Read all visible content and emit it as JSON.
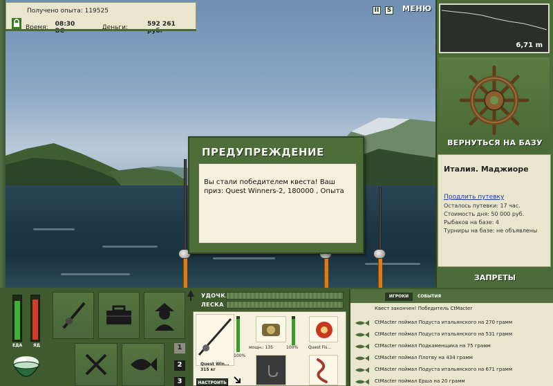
{
  "info": {
    "experience": "Получено опыта: 119525",
    "time_label": "Время:",
    "time_value": "08:30 ВС",
    "money_label": "Деньги:",
    "money_value": "592 261 руб."
  },
  "top_buttons": {
    "pause": "II",
    "sound": "S",
    "menu": "МЕНЮ"
  },
  "depth": {
    "value": "6,71 m"
  },
  "return_button": "ВЕРНУТЬСЯ НА БАЗУ",
  "location": {
    "title": "Италия. Маджиоре",
    "extend_link": "Продлить путевку",
    "lines": [
      "Осталось путевки: 17 час.",
      "Стоимость дня: 50 000 руб.",
      "Рыбаков на базе: 4",
      "Турниры на базе: не объявлены"
    ]
  },
  "bans_button": "ЗАПРЕТЫ",
  "modal": {
    "title": "ПРЕДУПРЕЖДЕНИЕ",
    "body": "Вы стали победителем квеста! Ваш приз: Quest Winners-2, 180000 , Опыта"
  },
  "meters": {
    "food_label": "ЕДА",
    "poison_label": "ЯД",
    "food_level": 0.88,
    "poison_level": 0.9,
    "food_color": "#3fb03a",
    "poison_color": "#d83a2a"
  },
  "bottom_tabs": [
    "1",
    "2",
    "3"
  ],
  "gear": {
    "rod_label": "УДОЧКА",
    "line_label": "ЛЕСКА",
    "rod_name": "Quest Win...",
    "rod_weight": "315 кг",
    "rod_percent": "100%",
    "reel_name": "мощн.: 135",
    "reel_percent": "100%",
    "item3_name": "Quest Fis...",
    "setup_button": "НАСТРОИТЬ"
  },
  "chat": {
    "tab_players": "ИГРОКИ",
    "tab_events": "СОБЫТИЯ",
    "first_line": "Квест закончен! Победитель CtMacter",
    "messages": [
      "CtMacter поймал Подуста итальянского на 270 грамм",
      "CtMacter поймал Подуста итальянского на 531 грамм",
      "CtMacter поймал Подкаменщика на 75 грамм",
      "CtMacter поймал Плотву на 434 грамм",
      "CtMacter поймал Подуста итальянского на 671 грамм",
      "CtMacter поймал Ерша на 20 грамм"
    ]
  }
}
